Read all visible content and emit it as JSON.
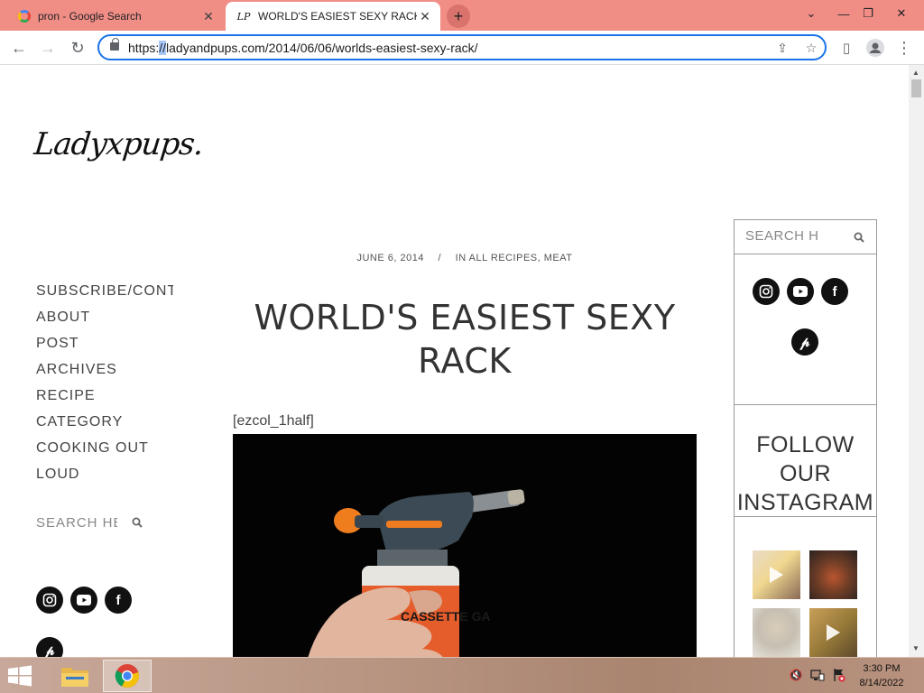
{
  "browser": {
    "tabs": [
      {
        "title": "pron - Google Search",
        "active": false
      },
      {
        "title": "WORLD'S EASIEST SEXY RACK – L",
        "active": true
      }
    ],
    "url_prefix": "https:",
    "url_selected": "//",
    "url_rest": "ladyandpups.com/2014/06/06/worlds-easiest-sexy-rack/"
  },
  "page": {
    "logo": "Ladyxpups.",
    "nav": [
      "SUBSCRIBE/CONTACT",
      "ABOUT",
      "POST",
      "ARCHIVES",
      "RECIPE",
      "CATEGORY",
      "COOKING OUT",
      "LOUD"
    ],
    "search_placeholder": "SEARCH HERE",
    "meta_date": "JUNE 6, 2014",
    "meta_sep": "/",
    "meta_in": "IN",
    "meta_cat1": "ALL RECIPES",
    "meta_comma": ",",
    "meta_cat2": "MEAT",
    "title": "WORLD'S EASIEST SEXY RACK",
    "shortcode": "[ezcol_1half]",
    "hero_can_text": "CASSETTE GA"
  },
  "sidebar": {
    "search_placeholder": "SEARCH HERE",
    "follow_lines": [
      "FOLLOW",
      "OUR",
      "INSTAGRAM"
    ]
  },
  "social_icons": [
    "instagram-icon",
    "youtube-icon",
    "facebook-icon",
    "pinterest-icon"
  ],
  "taskbar": {
    "time": "3:30 PM",
    "date": "8/14/2022"
  },
  "colors": {
    "tabstrip": "#f08e86",
    "omnibox_border": "#1a73e8",
    "taskbar": "#b89582"
  }
}
